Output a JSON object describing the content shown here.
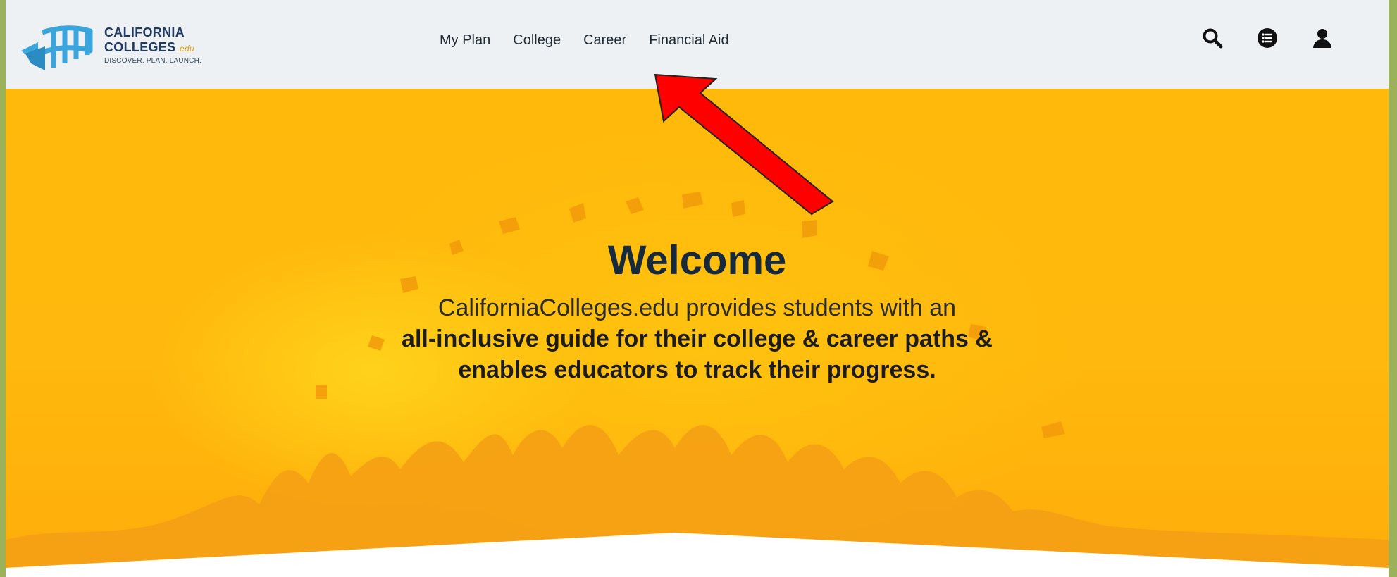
{
  "brand": {
    "line1": "CALIFORNIA",
    "line2": "COLLEGES",
    "suffix": ".edu",
    "tagline": "DISCOVER. PLAN. LAUNCH.",
    "color_primary": "#1f3b63",
    "color_mark": "#3aa5dc",
    "color_suffix": "#e79b00"
  },
  "nav": {
    "items": [
      {
        "label": "My Plan"
      },
      {
        "label": "College"
      },
      {
        "label": "Career"
      },
      {
        "label": "Financial Aid"
      }
    ]
  },
  "header_icons": [
    "search-icon",
    "list-icon",
    "user-icon"
  ],
  "hero": {
    "title": "Welcome",
    "description": "CaliforniaColleges.edu provides students with an",
    "highlight_line1": "all-inclusive guide for their college & career paths &",
    "highlight_line2": "enables educators to track their progress.",
    "background_color": "#ffb90b",
    "title_color": "#172a3d"
  },
  "annotation": {
    "arrow_color": "#ff0000",
    "points_to": "Career"
  }
}
